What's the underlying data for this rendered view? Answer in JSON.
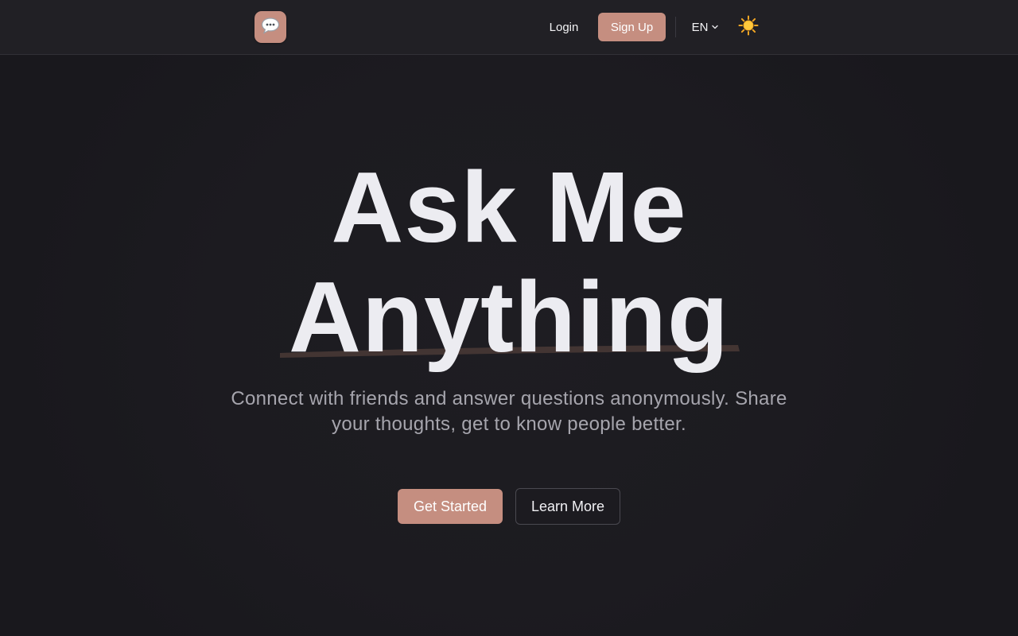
{
  "header": {
    "logo_icon": "speech-bubble-icon",
    "login_label": "Login",
    "signup_label": "Sign Up",
    "language_label": "EN",
    "theme_icon": "sun-icon"
  },
  "hero": {
    "title_line1": "Ask Me",
    "title_line2": "Anything",
    "subtitle": "Connect with friends and answer questions anonymously. Share your thoughts, get to know people better.",
    "primary_cta": "Get Started",
    "secondary_cta": "Learn More"
  },
  "colors": {
    "accent": "#c58e80",
    "background": "#1c1b20",
    "header_background": "#212025",
    "text": "#ececf1",
    "muted_text": "#a6a5ad"
  }
}
